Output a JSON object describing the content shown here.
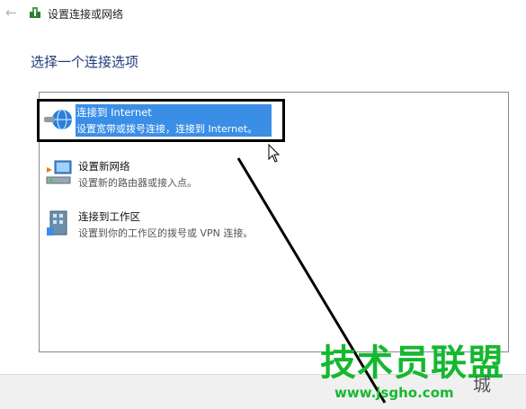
{
  "window": {
    "title": "设置连接或网络"
  },
  "heading": "选择一个连接选项",
  "options": [
    {
      "title": "连接到 Internet",
      "desc": "设置宽带或拨号连接，连接到 Internet。",
      "icon": "globe-icon",
      "selected": true
    },
    {
      "title": "设置新网络",
      "desc": "设置新的路由器或接入点。",
      "icon": "router-icon",
      "selected": false
    },
    {
      "title": "连接到工作区",
      "desc": "设置到你的工作区的拨号或 VPN 连接。",
      "icon": "workplace-icon",
      "selected": false
    }
  ],
  "watermark": {
    "main": "技术员联盟",
    "url": "www.jsgho.com",
    "side": "城"
  },
  "colors": {
    "highlight": "#3a8ee6",
    "heading": "#1e3a78",
    "watermark": "#15b82f"
  }
}
